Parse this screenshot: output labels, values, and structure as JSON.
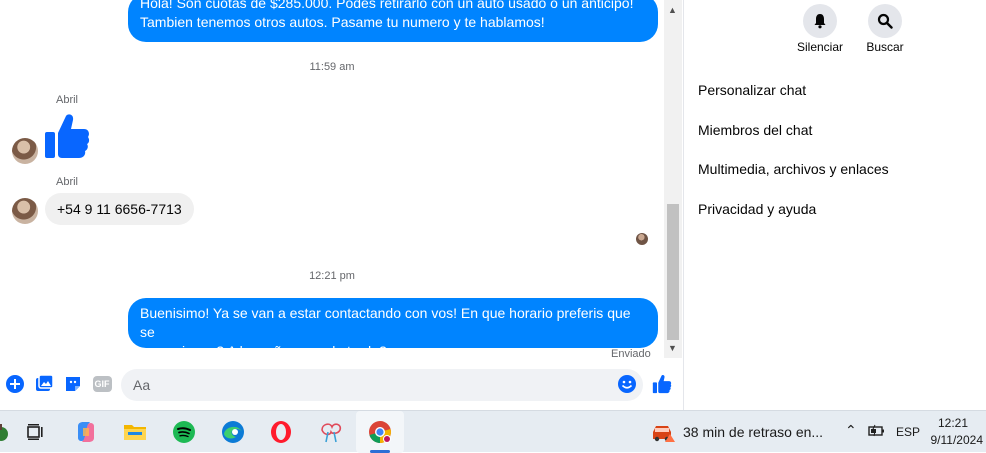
{
  "chat": {
    "first_message": {
      "line1": "Hola! Son cuotas de $285.000. Podes retirarlo con un auto usado o un anticipo!",
      "line2": "Tambien tenemos otros autos. Pasame tu numero y te hablamos!"
    },
    "time_1": "11:59 am",
    "sender_1": "Abril",
    "sender_2": "Abril",
    "phone_message": "+54 9 11 6656-7713",
    "time_2": "12:21 pm",
    "last_message": {
      "line1": "Buenisimo! Ya se van a estar contactando con vos! En que horario preferis que se",
      "line2": "comuniquen? A la mañana o a la tarde?"
    },
    "status": "Enviado"
  },
  "composer": {
    "placeholder": "Aa",
    "gif_label": "GIF"
  },
  "sidebar": {
    "mute_label": "Silenciar",
    "search_label": "Buscar",
    "menu": [
      "Personalizar chat",
      "Miembros del chat",
      "Multimedia, archivos y enlaces",
      "Privacidad y ayuda"
    ]
  },
  "taskbar": {
    "notification": "38 min de retraso en...",
    "language": "ESP",
    "time": "12:21",
    "date": "9/11/2024"
  },
  "colors": {
    "messenger_blue": "#0084ff",
    "icon_blue": "#0866ff",
    "taskbar_bg": "#e6ecf2"
  }
}
